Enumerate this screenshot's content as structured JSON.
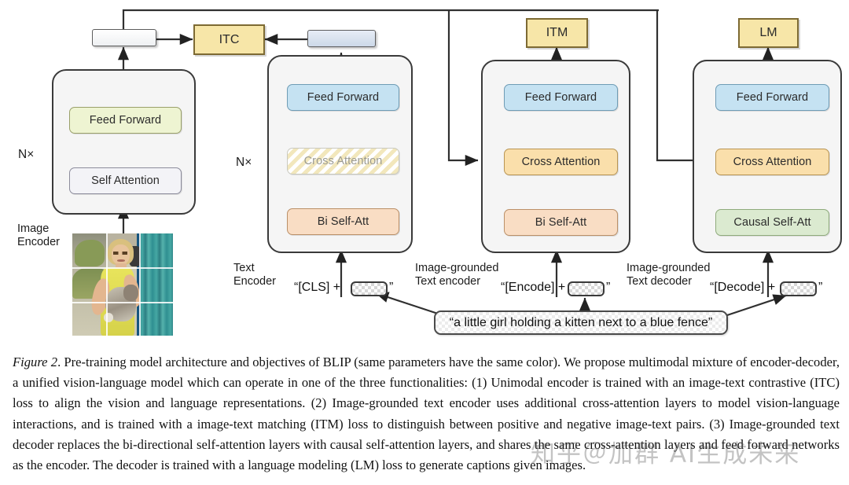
{
  "figure": {
    "modules": [
      {
        "id": "image-encoder",
        "label": "Image\nEncoder",
        "repeat": "N×",
        "layers": [
          "Feed Forward",
          "Self Attention"
        ],
        "output_bar": ""
      },
      {
        "id": "text-encoder",
        "label": "Text\nEncoder",
        "repeat": "N×",
        "layers": [
          "Feed Forward",
          "Cross Attention",
          "Bi Self-Att"
        ],
        "output_bar": "",
        "input_token": "“[CLS] + ",
        "input_token_end": "”"
      },
      {
        "id": "image-grounded-text-encoder",
        "label": "Image-grounded\nText encoder",
        "layers": [
          "Feed Forward",
          "Cross Attention",
          "Bi Self-Att"
        ],
        "input_token": "“[Encode] + ",
        "input_token_end": "”"
      },
      {
        "id": "image-grounded-text-decoder",
        "label": "Image-grounded\nText decoder",
        "layers": [
          "Feed Forward",
          "Cross Attention",
          "Causal Self-Att"
        ],
        "input_token": "“[Decode] + ",
        "input_token_end": "”"
      }
    ],
    "objectives": [
      {
        "id": "itc",
        "label": "ITC"
      },
      {
        "id": "itm",
        "label": "ITM"
      },
      {
        "id": "lm",
        "label": "LM"
      }
    ],
    "caption_text": "“a little girl holding a kitten next to a blue fence”",
    "colors": {
      "objective_yellow": "#f7e6a8",
      "feed_forward_image": "#eef4d2",
      "self_attention_image": "#f3f3f7",
      "feed_forward_blue": "#c5e2f2",
      "cross_attention_tan": "#fadfab",
      "bi_self_att": "#f9ddc4",
      "causal_self_att": "#dbead0",
      "module_bg": "#f5f5f5",
      "text_feature_bar": "#ccd8e8",
      "image_feature_bar": "#eef0f2"
    }
  },
  "caption": {
    "figure_label": "Figure 2",
    "body": ". Pre-training model architecture and objectives of BLIP (same parameters have the same color). We propose multimodal mixture of encoder-decoder, a unified vision-language model which can operate in one of the three functionalities: (1) Unimodal encoder is trained with an image-text contrastive (ITC) loss to align the vision and language representations. (2) Image-grounded text encoder uses additional cross-attention layers to model vision-language interactions, and is trained with a image-text matching (ITM) loss to distinguish between positive and negative image-text pairs. (3) Image-grounded text decoder replaces the bi-directional self-attention layers with causal self-attention layers, and shares the same cross-attention layers and feed forward networks as the encoder. The decoder is trained with a language modeling (LM) loss to generate captions given images."
  },
  "watermark": {
    "text": "知乎＠加群 AI生成未来"
  }
}
